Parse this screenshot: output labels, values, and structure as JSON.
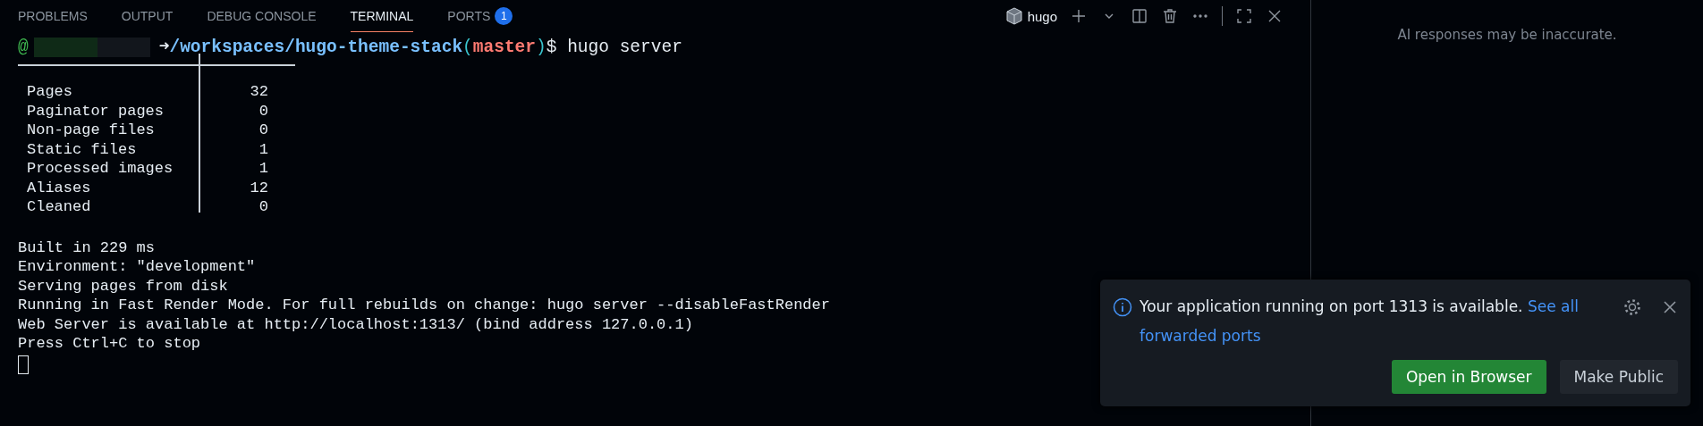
{
  "panel_tabs": [
    {
      "label": "PROBLEMS",
      "selected": false
    },
    {
      "label": "OUTPUT",
      "selected": false
    },
    {
      "label": "DEBUG CONSOLE",
      "selected": false
    },
    {
      "label": "TERMINAL",
      "selected": true
    },
    {
      "label": "PORTS",
      "selected": false,
      "badge": "1"
    }
  ],
  "terminal_toolbar": {
    "terminal_name": "hugo"
  },
  "prompt": {
    "user_marker": "@",
    "arrow": "➜",
    "path": "/workspaces/hugo-theme-stack",
    "branch": "(master)",
    "command": "$ hugo server"
  },
  "stats": [
    {
      "label": "Pages",
      "value": "32"
    },
    {
      "label": "Paginator pages",
      "value": "0"
    },
    {
      "label": "Non-page files",
      "value": "0"
    },
    {
      "label": "Static files",
      "value": "1"
    },
    {
      "label": "Processed images",
      "value": "1"
    },
    {
      "label": "Aliases",
      "value": "12"
    },
    {
      "label": "Cleaned",
      "value": "0"
    }
  ],
  "output_lines": [
    "Built in 229 ms",
    "Environment: \"development\"",
    "Serving pages from disk",
    "Running in Fast Render Mode. For full rebuilds on change: hugo server --disableFastRender",
    "Web Server is available at http://localhost:1313/ (bind address 127.0.0.1)",
    "Press Ctrl+C to stop"
  ],
  "side_panel": {
    "notice": "AI responses may be inaccurate."
  },
  "notification": {
    "message": "Your application running on port 1313 is available.",
    "link": "See all forwarded ports",
    "buttons": [
      {
        "label": "Open in Browser",
        "kind": "primary"
      },
      {
        "label": "Make Public",
        "kind": "secondary"
      }
    ]
  }
}
